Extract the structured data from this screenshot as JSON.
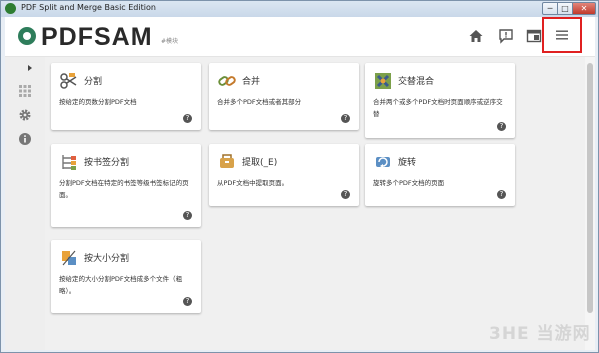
{
  "window": {
    "title": "PDF Split and Merge Basic Edition",
    "minimize": "─",
    "maximize": "□",
    "close": "✕"
  },
  "header": {
    "logo_text": "PDFSAM",
    "logo_sub": "#模块",
    "icons": [
      "home-icon",
      "news-icon",
      "workspace-icon",
      "menu-icon"
    ]
  },
  "sidebar": {
    "icons": [
      "expand-icon",
      "modules-icon",
      "settings-icon",
      "info-icon"
    ]
  },
  "modules": [
    {
      "title": "分割",
      "desc": "按给定的页数分割PDF文档",
      "icon": "split-icon",
      "help": "?"
    },
    {
      "title": "合并",
      "desc": "合并多个PDF文档或者其部分",
      "icon": "merge-icon",
      "help": "?"
    },
    {
      "title": "交替混合",
      "desc": "合并两个或多个PDF文档时页面顺序或逆序交替",
      "icon": "alternate-mix-icon",
      "help": "?"
    },
    {
      "title": "按书签分割",
      "desc": "分割PDF文档在特定的书签等级书签标记的页面。",
      "icon": "split-by-bookmarks-icon",
      "help": "?"
    },
    {
      "title": "提取(_E)",
      "desc": "从PDF文档中提取页面。",
      "icon": "extract-icon",
      "help": "?"
    },
    {
      "title": "旋转",
      "desc": "旋转多个PDF文档的页面",
      "icon": "rotate-icon",
      "help": "?"
    },
    {
      "title": "按大小分割",
      "desc": "按给定的大小分割PDF文档成多个文件（粗略）。",
      "icon": "split-by-size-icon",
      "help": "?"
    }
  ],
  "watermark": "3HE 当游网",
  "colors": {
    "accent": "#2e7d5b",
    "highlight_box": "#e02020"
  }
}
